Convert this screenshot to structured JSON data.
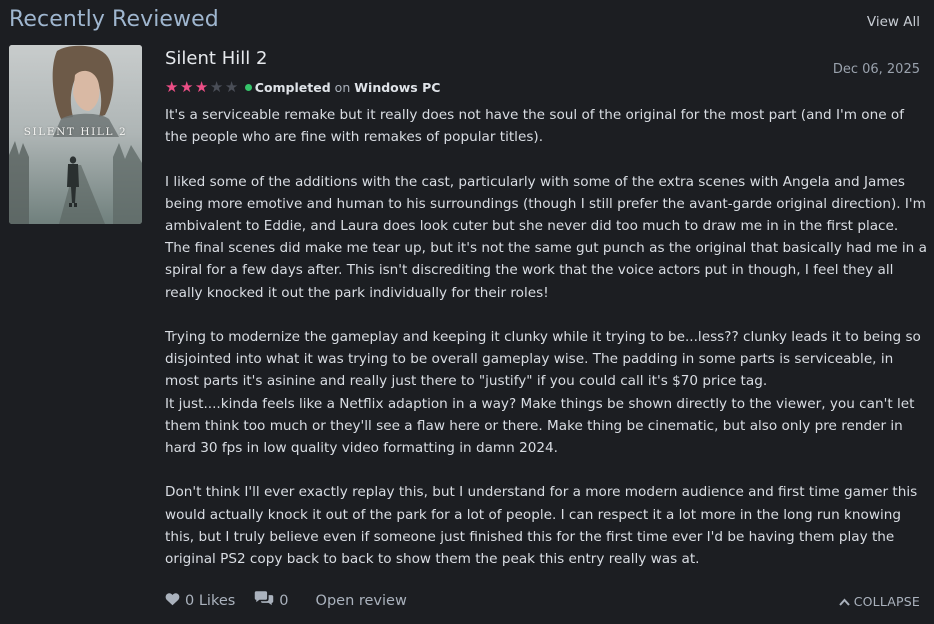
{
  "header": {
    "title": "Recently Reviewed",
    "view_all": "View All"
  },
  "review": {
    "game_title": "Silent Hill 2",
    "cover_text": "SILENT HILL 2",
    "date": "Dec 06, 2025",
    "rating": 3,
    "rating_max": 5,
    "status": "Completed",
    "platform_prefix": "on",
    "platform": "Windows PC",
    "colors": {
      "star_on": "#ec4e86",
      "star_off": "#4a4e57",
      "status": "#35c46a",
      "accent": "#9fb6cf"
    },
    "body": {
      "p1": "It's a serviceable remake but it really does not have the soul of the original for the most part (and I'm one of the people who are fine with remakes of popular titles).",
      "p2": "I liked some of the additions with the cast, particularly with some of the extra scenes with Angela and James being more emotive and human to his surroundings (though I still prefer the avant-garde original direction). I'm ambivalent to Eddie, and Laura does look cuter but she never did too much to draw me in in the first place. The final scenes did make me tear up, but it's not the same gut punch as the original that basically had me in a spiral for a few days after. This isn't discrediting the work that the voice actors put in though, I feel they all really knocked it out the park individually for their roles!",
      "p3": "Trying to modernize the gameplay and keeping it clunky while it trying to be...less?? clunky leads it to being so disjointed into what it was trying to be overall gameplay wise. The padding in some parts is serviceable, in most parts it's asinine and really just there to \"justify\" if you could call it's $70 price tag.",
      "p4": "It just....kinda feels like a Netflix adaption in a way? Make things be shown directly to the viewer, you can't let them think too much or they'll see a flaw here or there. Make thing be cinematic, but also only pre render in hard 30 fps in low quality video formatting in damn 2024.",
      "p5": "Don't think I'll ever exactly replay this, but I understand for a more modern audience and first time gamer this would actually knock it out of the park for a lot of people. I can respect it a lot more in the long run knowing this, but I truly believe even if someone just finished this for the first time ever I'd be having them play the original PS2 copy back to back to show them the peak this entry really was at."
    },
    "footer": {
      "likes": "0 Likes",
      "comments": "0",
      "open_review": "Open review",
      "collapse": "COLLAPSE"
    }
  }
}
